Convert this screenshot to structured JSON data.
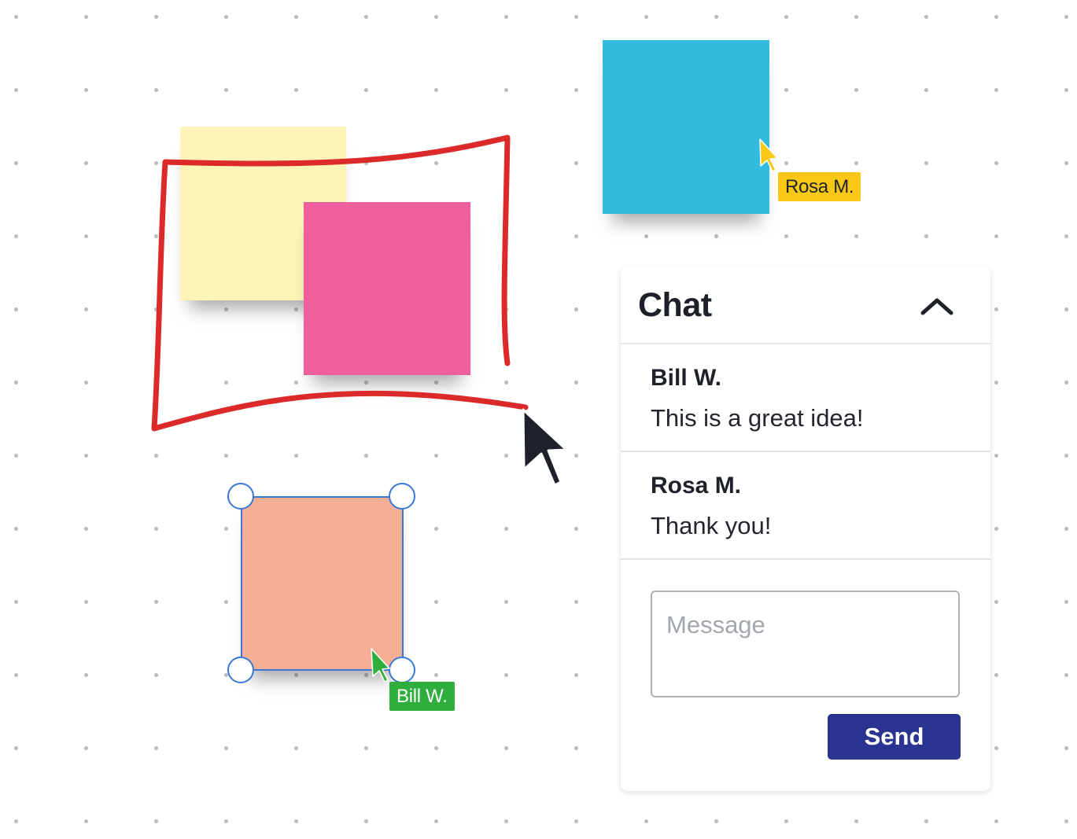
{
  "board": {
    "background": "#ffffff",
    "dot_color": "#b9bcc2",
    "stickies": [
      {
        "name": "yellow",
        "color": "#fff4b8"
      },
      {
        "name": "pink",
        "color": "#ef5f9b"
      },
      {
        "name": "blue",
        "color": "#31bcdf"
      },
      {
        "name": "peach",
        "color": "#f6ae96"
      }
    ],
    "ink_color": "#dc2a2a",
    "selection_color": "#3a78d6"
  },
  "collaborators": {
    "rosa": {
      "label": "Rosa M.",
      "color": "#f9c817"
    },
    "bill": {
      "label": "Bill W.",
      "color": "#2fae3e"
    }
  },
  "local_cursor": {
    "icon": "arrow-cursor-icon",
    "color": "#1e2228"
  },
  "chat": {
    "title": "Chat",
    "collapse_icon": "chevron-up-icon",
    "messages": [
      {
        "author": "Bill W.",
        "text": "This is a great idea!"
      },
      {
        "author": "Rosa M.",
        "text": "Thank you!"
      }
    ],
    "input": {
      "placeholder": "Message",
      "value": ""
    },
    "send_label": "Send",
    "send_color": "#2b3390"
  }
}
